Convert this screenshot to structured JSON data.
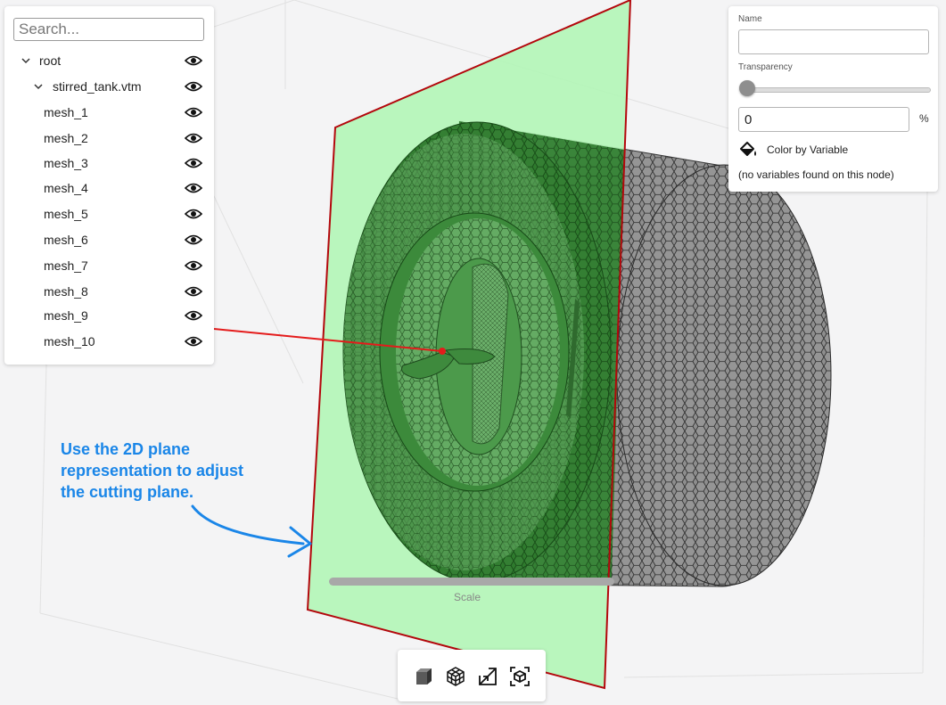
{
  "tree": {
    "search_placeholder": "Search...",
    "items": [
      {
        "label": "root"
      },
      {
        "label": "stirred_tank.vtm"
      },
      {
        "label": "mesh_1"
      },
      {
        "label": "mesh_2"
      },
      {
        "label": "mesh_3"
      },
      {
        "label": "mesh_4"
      },
      {
        "label": "mesh_5"
      },
      {
        "label": "mesh_6"
      },
      {
        "label": "mesh_7"
      },
      {
        "label": "mesh_8"
      },
      {
        "label": "mesh_9"
      },
      {
        "label": "mesh_10"
      }
    ]
  },
  "properties": {
    "name_label": "Name",
    "name_value": "",
    "transparency_label": "Transparency",
    "transparency_value": "0",
    "transparency_slider_fraction": 0,
    "percent_unit": "%",
    "color_by_variable_label": "Color by Variable",
    "no_variables_message": "(no variables found on this node)"
  },
  "annotation": {
    "line1": "Use the 2D plane",
    "line2": "representation to adjust",
    "line3": "the cutting plane."
  },
  "scale": {
    "label": "Scale"
  },
  "toolbar": {
    "icons": [
      "solid-cube-icon",
      "wireframe-cube-icon",
      "expand-arrow-icon",
      "focus-cube-icon"
    ]
  },
  "colors": {
    "plane_fill": "#b3f5b7",
    "plane_edge": "#b3070c",
    "green_mesh": "#2f7a2f",
    "gray_mesh": "#8c8c8c",
    "annotation": "#1a86e8"
  }
}
